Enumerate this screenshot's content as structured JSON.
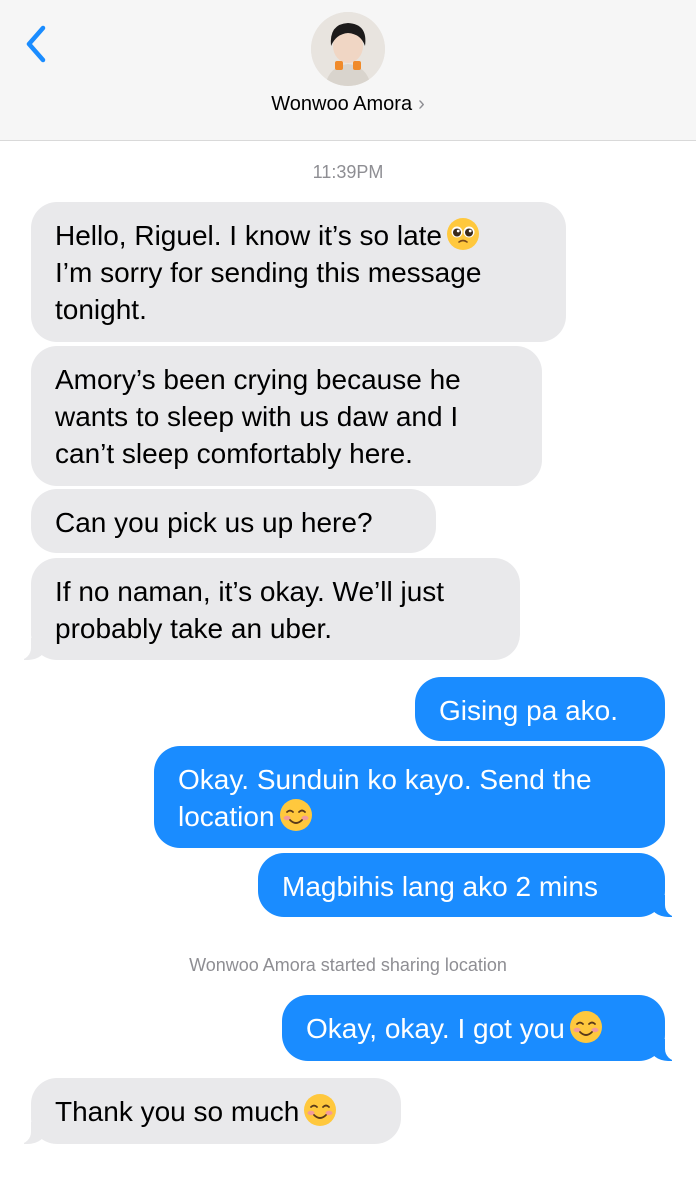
{
  "header": {
    "back_icon": "chevron-left-icon",
    "contact_name": "Wonwoo Amora",
    "chevron": "›",
    "accent_color": "#1a8cff"
  },
  "conversation": {
    "timestamp": "11:39PM",
    "messages": [
      {
        "from": "them",
        "lines": [
          "Hello, Riguel. I know it’s so late",
          "I’m sorry for sending this message",
          "tonight."
        ],
        "emoji": "pleading-face"
      },
      {
        "from": "them",
        "lines": [
          "Amory’s been crying because he",
          "wants to sleep with us daw and I",
          "can’t sleep comfortably here."
        ]
      },
      {
        "from": "them",
        "lines": [
          "Can you pick us up here?"
        ]
      },
      {
        "from": "them",
        "lines": [
          "If no naman, it’s okay. We’ll just",
          "probably take an uber."
        ]
      },
      {
        "from": "me",
        "lines": [
          "Gising pa ako."
        ]
      },
      {
        "from": "me",
        "lines": [
          "Okay. Sunduin ko kayo. Send the",
          "location"
        ],
        "emoji": "smiling-face"
      },
      {
        "from": "me",
        "lines": [
          "Magbihis lang ako 2 mins"
        ]
      },
      {
        "from": "me",
        "lines": [
          "Okay, okay. I got you"
        ],
        "emoji": "smiling-face"
      },
      {
        "from": "them",
        "lines": [
          "Thank you so much"
        ],
        "emoji": "smiling-face"
      }
    ],
    "system_notice": "Wonwoo Amora started sharing location"
  }
}
